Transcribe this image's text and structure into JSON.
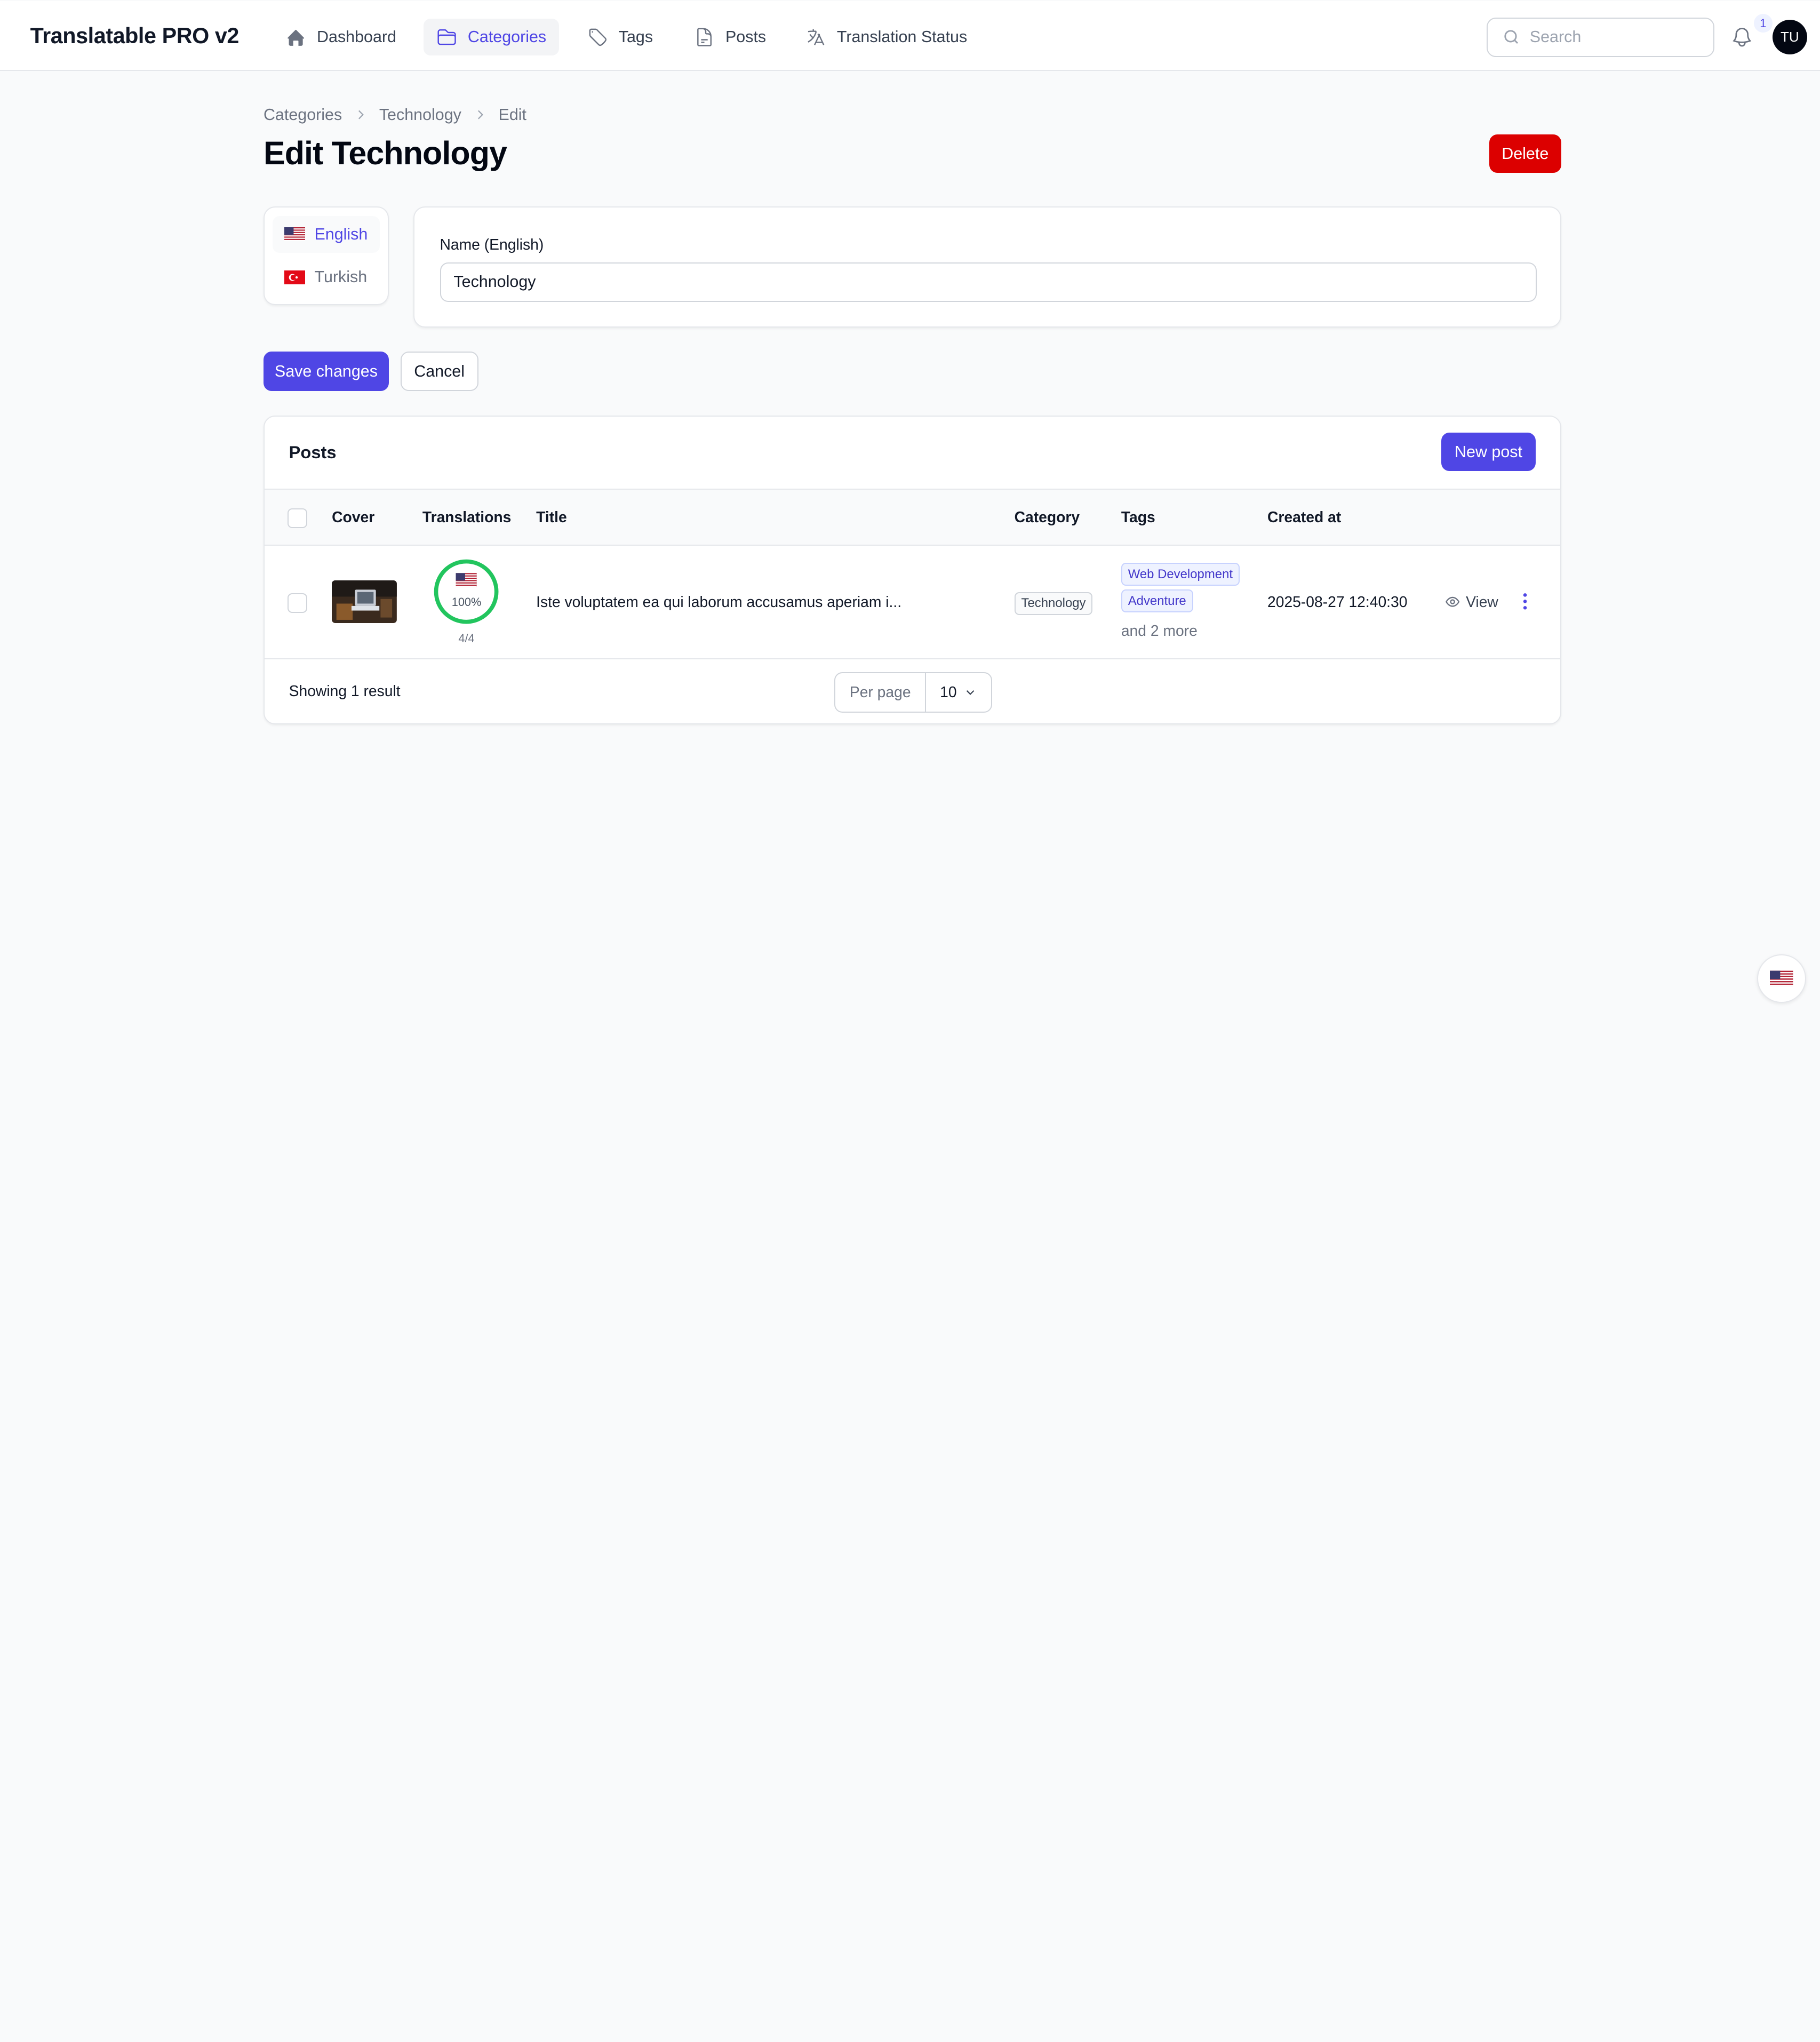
{
  "app": {
    "title": "Translatable PRO v2"
  },
  "nav": {
    "items": [
      {
        "label": "Dashboard",
        "icon": "home-icon"
      },
      {
        "label": "Categories",
        "icon": "folder-icon"
      },
      {
        "label": "Tags",
        "icon": "tag-icon"
      },
      {
        "label": "Posts",
        "icon": "document-icon"
      },
      {
        "label": "Translation Status",
        "icon": "language-icon"
      }
    ],
    "active": "Categories"
  },
  "search": {
    "placeholder": "Search"
  },
  "notifications": {
    "count": "1"
  },
  "user": {
    "initials": "TU"
  },
  "breadcrumb": [
    "Categories",
    "Technology",
    "Edit"
  ],
  "page": {
    "title": "Edit Technology",
    "delete_label": "Delete"
  },
  "locales": [
    {
      "label": "English",
      "flag": "us-flag-icon",
      "active": true
    },
    {
      "label": "Turkish",
      "flag": "tr-flag-icon",
      "active": false
    }
  ],
  "form": {
    "name_label": "Name (English)",
    "name_value": "Technology"
  },
  "actions": {
    "save_label": "Save changes",
    "cancel_label": "Cancel"
  },
  "posts": {
    "title": "Posts",
    "new_label": "New post",
    "columns": [
      "Cover",
      "Translations",
      "Title",
      "Category",
      "Tags",
      "Created at"
    ],
    "rows": [
      {
        "translation_percent": "100%",
        "translation_fraction": "4/4",
        "title": "Iste voluptatem ea qui laborum accusamus aperiam i...",
        "category": "Technology",
        "tags": [
          "Web Development",
          "Adventure"
        ],
        "more_tags": "and 2 more",
        "created_at": "2025-08-27 12:40:30",
        "view_label": "View"
      }
    ],
    "summary": "Showing 1 result",
    "per_page_label": "Per page",
    "per_page_value": "10"
  },
  "colors": {
    "accent": "#4f46e5",
    "danger": "#dc0000",
    "success": "#22c55e"
  }
}
